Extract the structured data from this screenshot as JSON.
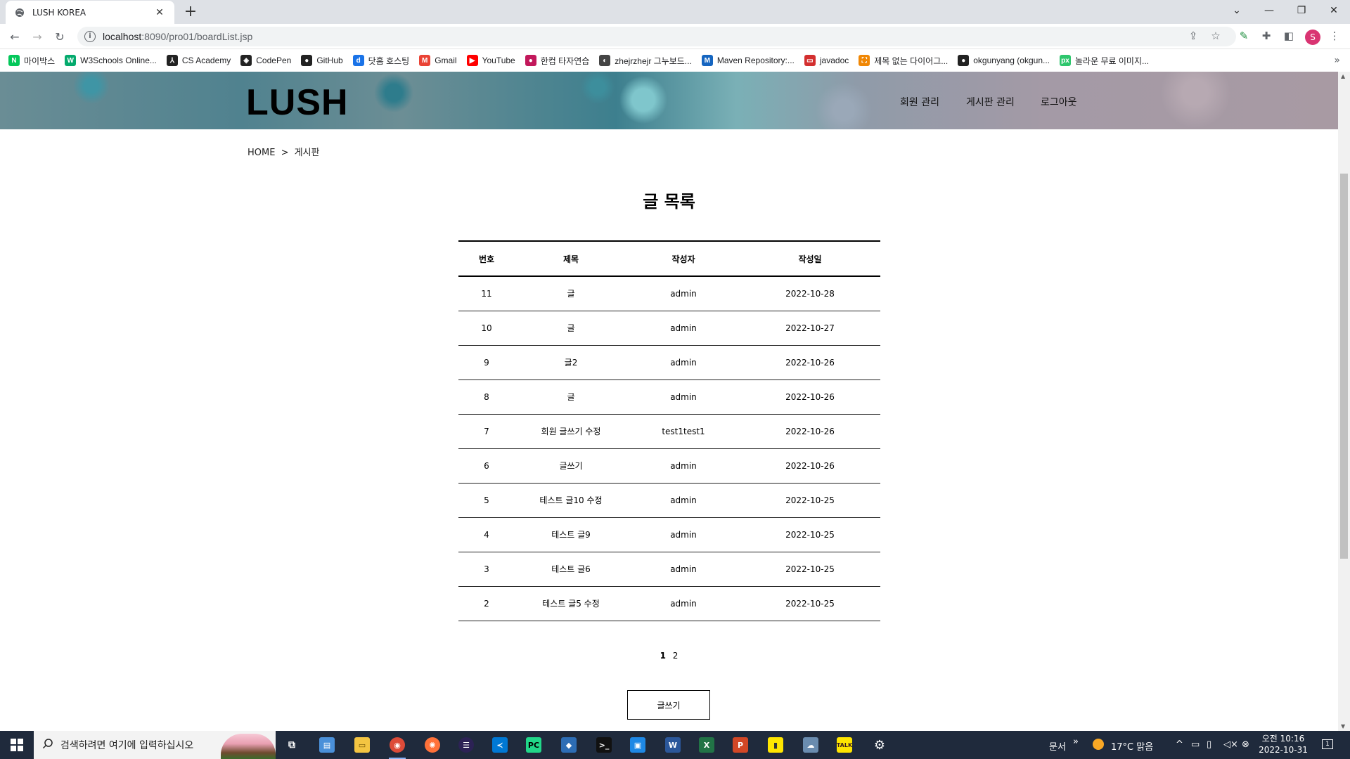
{
  "browser": {
    "tab_title": "LUSH KOREA",
    "tab_close": "✕",
    "new_tab": "+",
    "url_host": "localhost",
    "url_path": ":8090/pro01/boardList.jsp",
    "profile_initial": "S"
  },
  "bookmarks": [
    {
      "label": "마이박스",
      "icon": "naver-icon",
      "color": "#03c75a",
      "glyph": "N"
    },
    {
      "label": "W3Schools Online...",
      "icon": "w3schools-icon",
      "color": "#04aa6d",
      "glyph": "W"
    },
    {
      "label": "CS Academy",
      "icon": "cs-academy-icon",
      "color": "#222222",
      "glyph": "⅄"
    },
    {
      "label": "CodePen",
      "icon": "codepen-icon",
      "color": "#222222",
      "glyph": "◈"
    },
    {
      "label": "GitHub",
      "icon": "github-icon",
      "color": "#222222",
      "glyph": "●"
    },
    {
      "label": "닷홈 호스팅",
      "icon": "dothome-icon",
      "color": "#1a73e8",
      "glyph": "d"
    },
    {
      "label": "Gmail",
      "icon": "gmail-icon",
      "color": "#ea4335",
      "glyph": "M"
    },
    {
      "label": "YouTube",
      "icon": "youtube-icon",
      "color": "#ff0000",
      "glyph": "▶"
    },
    {
      "label": "한컴 타자연습",
      "icon": "hancom-icon",
      "color": "#c2185b",
      "glyph": "●"
    },
    {
      "label": "zhejrzhejr 그누보드...",
      "icon": "gnuboard-icon",
      "color": "#444444",
      "glyph": "◐"
    },
    {
      "label": "Maven Repository:...",
      "icon": "maven-icon",
      "color": "#1565c0",
      "glyph": "M"
    },
    {
      "label": "javadoc",
      "icon": "oracle-icon",
      "color": "#d32f2f",
      "glyph": "▭"
    },
    {
      "label": "제목 없는 다이어그...",
      "icon": "drawio-icon",
      "color": "#f08705",
      "glyph": "⛶"
    },
    {
      "label": "okgunyang (okgun...",
      "icon": "github-icon",
      "color": "#222222",
      "glyph": "●"
    },
    {
      "label": "놀라운 무료 이미지...",
      "icon": "pixabay-icon",
      "color": "#2ec66d",
      "glyph": "px"
    }
  ],
  "site": {
    "logo": "LUSH",
    "nav": [
      "회원 관리",
      "게시판 관리",
      "로그아웃"
    ],
    "breadcrumb": {
      "home": "HOME",
      "sep": ">",
      "current": "게시판"
    },
    "page_title": "글 목록"
  },
  "board": {
    "headers": [
      "번호",
      "제목",
      "작성자",
      "작성일"
    ],
    "rows": [
      [
        "11",
        "글",
        "admin",
        "2022-10-28"
      ],
      [
        "10",
        "글",
        "admin",
        "2022-10-27"
      ],
      [
        "9",
        "글2",
        "admin",
        "2022-10-26"
      ],
      [
        "8",
        "글",
        "admin",
        "2022-10-26"
      ],
      [
        "7",
        "회원 글쓰기 수정",
        "test1test1",
        "2022-10-26"
      ],
      [
        "6",
        "글쓰기",
        "admin",
        "2022-10-26"
      ],
      [
        "5",
        "테스트 글10 수정",
        "admin",
        "2022-10-25"
      ],
      [
        "4",
        "테스트 글9",
        "admin",
        "2022-10-25"
      ],
      [
        "3",
        "테스트 글6",
        "admin",
        "2022-10-25"
      ],
      [
        "2",
        "테스트 글5 수정",
        "admin",
        "2022-10-25"
      ]
    ]
  },
  "pagination": {
    "pages": [
      "1",
      "2"
    ],
    "current": "1"
  },
  "write_button": "글쓰기",
  "taskbar": {
    "search_placeholder": "검색하려면 여기에 입력하십시오",
    "tray_doc": "문서",
    "weather": "17°C 맑음",
    "time": "오전 10:16",
    "date": "2022-10-31",
    "notification_count": "1"
  }
}
